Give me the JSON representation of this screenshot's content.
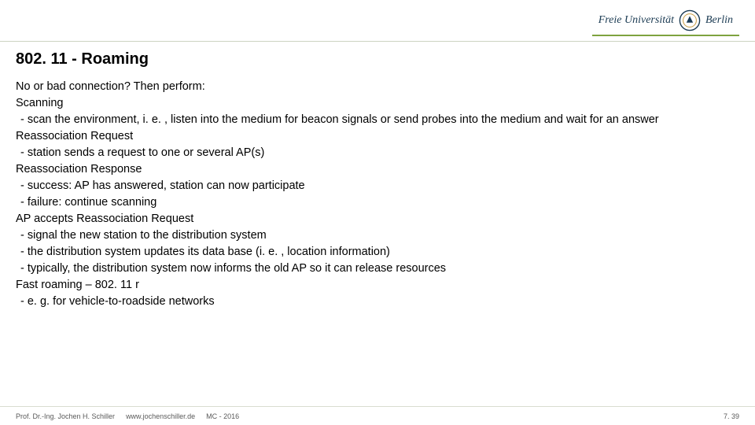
{
  "header": {
    "logo_text_a": "Freie Universität",
    "logo_text_b": "Berlin"
  },
  "title": "802. 11 - Roaming",
  "body": {
    "intro": "No or bad connection? Then perform:",
    "s1_h": "Scanning",
    "s1_1": "scan the environment, i. e. , listen into the medium for beacon signals or send probes into the medium and wait for an answer",
    "s2_h": "Reassociation Request",
    "s2_1": "station sends a request to one or several AP(s)",
    "s3_h": "Reassociation Response",
    "s3_1": "success: AP has answered, station can now participate",
    "s3_2": "failure: continue scanning",
    "s4_h": "AP accepts Reassociation Request",
    "s4_1": "signal the new station to the distribution system",
    "s4_2": "the distribution system updates its data base (i. e. , location information)",
    "s4_3": "typically, the distribution system now informs the old AP so it can release resources",
    "s5_h": "Fast roaming – 802. 11 r",
    "s5_1": "e. g. for vehicle-to-roadside networks"
  },
  "footer": {
    "author": "Prof. Dr.-Ing. Jochen H. Schiller",
    "url": "www.jochenschiller.de",
    "course": "MC - 2016",
    "page": "7. 39"
  }
}
